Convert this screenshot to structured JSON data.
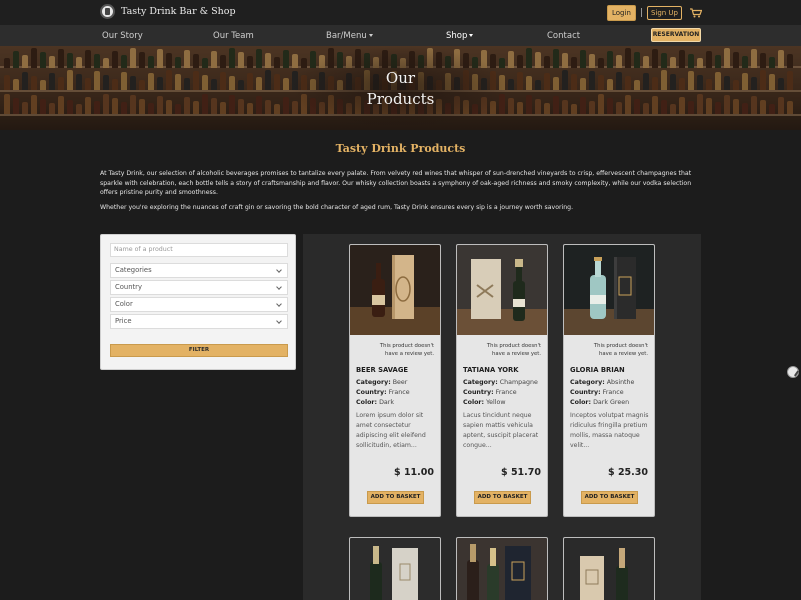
{
  "header": {
    "brand_name": "Tasty Drink Bar & Shop",
    "login_label": "Login",
    "separator": "|",
    "signup_label": "Sign Up",
    "cart_icon": "cart-icon"
  },
  "nav": {
    "items": [
      {
        "label": "Our Story"
      },
      {
        "label": "Our Team"
      },
      {
        "label": "Bar/Menu"
      },
      {
        "label": "Shop"
      },
      {
        "label": "Contact"
      }
    ],
    "reservation_label": "RESERVATION"
  },
  "hero": {
    "title_line1": "Our",
    "title_line2": "Products"
  },
  "intro": {
    "title": "Tasty Drink Products",
    "paragraph1": "At Tasty Drink, our selection of alcoholic beverages promises to tantalize every palate. From velvety red wines that whisper of sun-drenched vineyards to crisp, effervescent champagnes that sparkle with celebration, each bottle tells a story of craftsmanship and flavor. Our whisky collection boasts a symphony of oak-aged richness and smoky complexity, while our vodka selection offers pristine purity and smoothness.",
    "paragraph2": "Whether you're exploring the nuances of craft gin or savoring the bold character of aged rum, Tasty Drink ensures every sip is a journey worth savoring."
  },
  "filter": {
    "name_placeholder": "Name of a product",
    "selects": [
      {
        "label": "Categories"
      },
      {
        "label": "Country"
      },
      {
        "label": "Color"
      },
      {
        "label": "Price"
      }
    ],
    "filter_label": "FILTER"
  },
  "products": [
    {
      "review_text": "This product doesn't have a review yet.",
      "name": "BEER SAVAGE",
      "category_label": "Category:",
      "category": "Beer",
      "country_label": "Country:",
      "country": "France",
      "color_label": "Color:",
      "color": "Dark",
      "description": "Lorem ipsum dolor sit amet consectetur adipiscing elit eleifend sollicitudin, etiam...",
      "price": "$ 11.00",
      "basket_label": "ADD TO BASKET"
    },
    {
      "review_text": "This product doesn't have a review yet.",
      "name": "TATIANA YORK",
      "category_label": "Category:",
      "category": "Champagne",
      "country_label": "Country:",
      "country": "France",
      "color_label": "Color:",
      "color": "Yellow",
      "description": "Lacus tincidunt neque sapien mattis vehicula aptent, suscipit placerat congue...",
      "price": "$ 51.70",
      "basket_label": "ADD TO BASKET"
    },
    {
      "review_text": "This product doesn't have a review yet.",
      "name": "GLORIA BRIAN",
      "category_label": "Category:",
      "category": "Absinthe",
      "country_label": "Country:",
      "country": "France",
      "color_label": "Color:",
      "color": "Dark Green",
      "description": "Inceptos volutpat magnis ridiculus fringilla pretium mollis, massa natoque velit...",
      "price": "$ 25.30",
      "basket_label": "ADD TO BASKET"
    }
  ],
  "colors": {
    "accent": "#e3b264",
    "background": "#1c1c1c",
    "nav": "#2d2d2d",
    "card": "#e6e6e6"
  }
}
